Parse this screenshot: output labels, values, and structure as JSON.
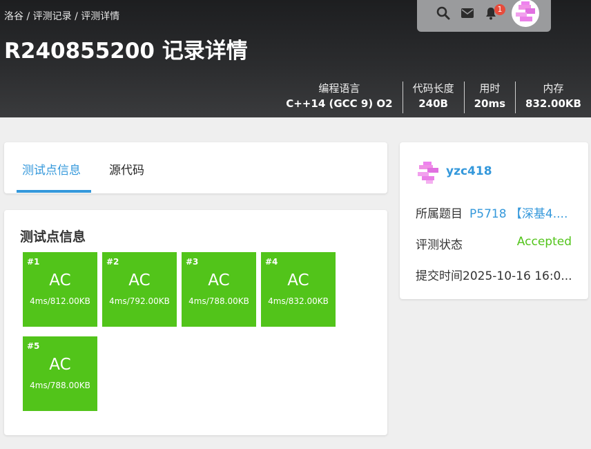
{
  "breadcrumb": {
    "home": "洛谷",
    "records": "评测记录",
    "current": "评测详情",
    "sep": " / "
  },
  "page_title": "R240855200 记录详情",
  "topbar": {
    "notification_count": "1"
  },
  "stats": [
    {
      "label": "编程语言",
      "value": "C++14 (GCC 9) O2"
    },
    {
      "label": "代码长度",
      "value": "240B"
    },
    {
      "label": "用时",
      "value": "20ms"
    },
    {
      "label": "内存",
      "value": "832.00KB"
    }
  ],
  "tabs": [
    {
      "label": "测试点信息",
      "active": true
    },
    {
      "label": "源代码",
      "active": false
    }
  ],
  "testcases": {
    "title": "测试点信息",
    "items": [
      {
        "num": "#1",
        "status": "AC",
        "detail": "4ms/812.00KB"
      },
      {
        "num": "#2",
        "status": "AC",
        "detail": "4ms/792.00KB"
      },
      {
        "num": "#3",
        "status": "AC",
        "detail": "4ms/788.00KB"
      },
      {
        "num": "#4",
        "status": "AC",
        "detail": "4ms/832.00KB"
      },
      {
        "num": "#5",
        "status": "AC",
        "detail": "4ms/788.00KB"
      }
    ]
  },
  "sidebar": {
    "username": "yzc418",
    "problem_label": "所属题目",
    "problem_value": "P5718 【深基4....",
    "status_label": "评测状态",
    "status_value": "Accepted",
    "time_label": "提交时间",
    "time_value": "2025-10-16 16:0..."
  },
  "colors": {
    "accent": "#3498db",
    "ac_green": "#52c41a",
    "accepted_text": "#52c41a",
    "badge_red": "#e74c3c"
  },
  "icons": [
    "search-icon",
    "mail-icon",
    "bell-icon"
  ]
}
